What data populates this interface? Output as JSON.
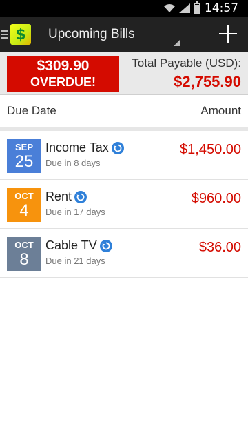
{
  "status_bar": {
    "time": "14:57"
  },
  "action_bar": {
    "app_icon_glyph": "$",
    "title": "Upcoming Bills"
  },
  "summary": {
    "overdue_amount": "$309.90",
    "overdue_label": "OVERDUE!",
    "total_label": "Total Payable (USD):",
    "total_amount": "$2,755.90"
  },
  "list_header": {
    "due_date": "Due Date",
    "amount": "Amount"
  },
  "bills": [
    {
      "month": "SEP",
      "day": "25",
      "name": "Income Tax",
      "due": "Due in 8 days",
      "amount": "$1,450.00",
      "color": "#4a7fd8"
    },
    {
      "month": "OCT",
      "day": "4",
      "name": "Rent",
      "due": "Due in 17 days",
      "amount": "$960.00",
      "color": "#f7930d"
    },
    {
      "month": "OCT",
      "day": "8",
      "name": "Cable TV",
      "due": "Due in 21 days",
      "amount": "$36.00",
      "color": "#6c7f97"
    }
  ],
  "colors": {
    "overdue_red": "#d40b00",
    "action_bar": "#222222",
    "repeat_blue": "#2f80d9"
  }
}
